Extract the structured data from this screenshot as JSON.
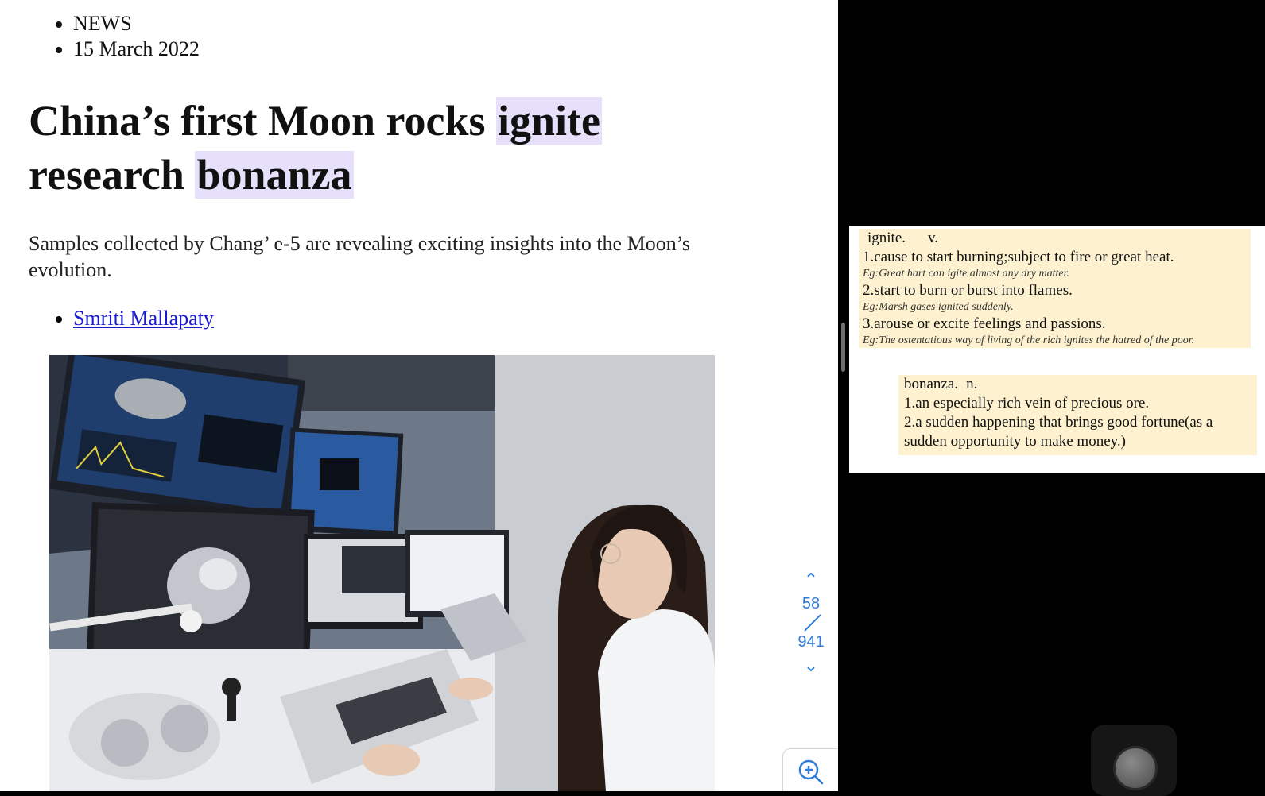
{
  "article": {
    "section": "NEWS",
    "date": "15 March 2022",
    "title_part1": "China’s first Moon rocks ",
    "title_hl1": "ignite",
    "title_part2": "research ",
    "title_hl2": "bonanza",
    "subtitle": "Samples collected by Chang’ e-5 are revealing exciting insights into the Moon’s evolution.",
    "author": "Smriti Mallapaty"
  },
  "pager": {
    "up_icon": "chevron-up-icon",
    "current": "58",
    "total": "941",
    "down_icon": "chevron-down-icon",
    "zoom_icon": "zoom-in-icon"
  },
  "dictionary": {
    "ignite": {
      "word": "ignite.",
      "pos": "v.",
      "senses": [
        {
          "def": "1.cause to start burning;subject to fire or great heat.",
          "eg": "Eg:Great hart can igite almost any dry matter."
        },
        {
          "def": "2.start to burn or burst into flames.",
          "eg": "Eg:Marsh gases ignited suddenly."
        },
        {
          "def": "3.arouse or excite feelings and passions.",
          "eg": "Eg:The ostentatious way of living of the rich ignites the hatred of the poor."
        }
      ]
    },
    "bonanza": {
      "word": "bonanza.",
      "pos": "n.",
      "senses": [
        "1.an especially rich vein of precious ore.",
        "2.a sudden happening that brings good fortune(as a sudden opportunity to make money.)"
      ]
    }
  },
  "colors": {
    "highlight": "#e6e0fb",
    "dict_bg": "#fdf1cf",
    "link": "#1a1ad0",
    "pager": "#2f7bd8"
  }
}
